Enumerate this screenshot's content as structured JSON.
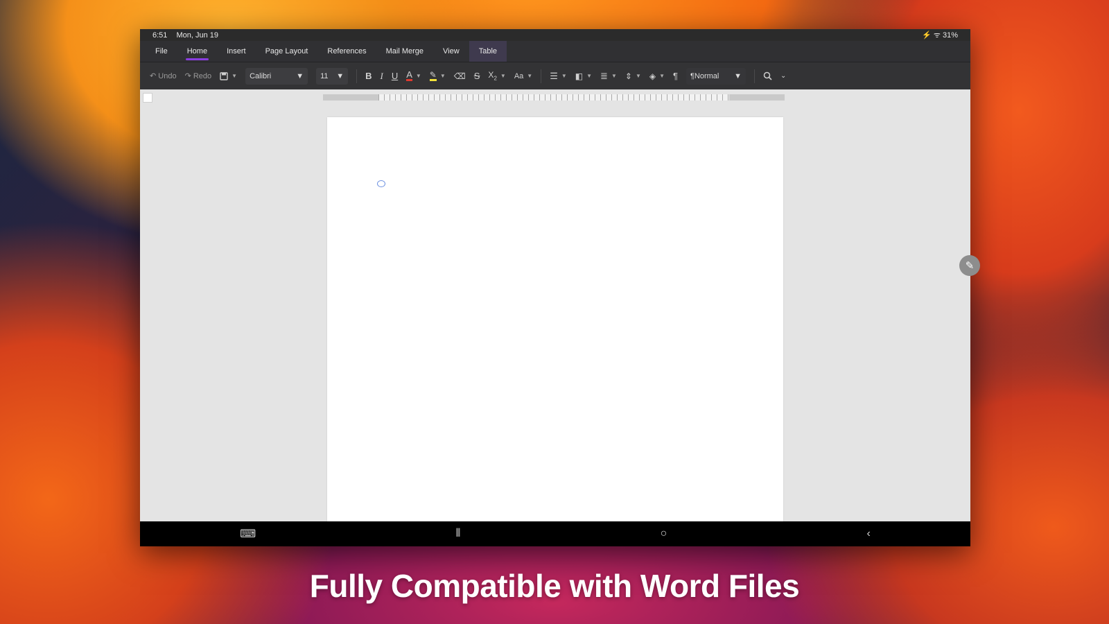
{
  "status_bar": {
    "time": "6:51",
    "date": "Mon, Jun 19",
    "indicators": "⚡ ᯤ 31%"
  },
  "menu": {
    "tabs": [
      {
        "label": "File"
      },
      {
        "label": "Home"
      },
      {
        "label": "Insert"
      },
      {
        "label": "Page Layout"
      },
      {
        "label": "References"
      },
      {
        "label": "Mail Merge"
      },
      {
        "label": "View"
      },
      {
        "label": "Table"
      }
    ],
    "active_tab": "Home"
  },
  "toolbar": {
    "undo_label": "Undo",
    "redo_label": "Redo",
    "font_name": "Calibri",
    "font_size": "11",
    "style_name": "¶Normal",
    "accent_color": "#8a3de0",
    "icons": [
      "save-icon",
      "bold-icon",
      "italic-icon",
      "underline-icon",
      "font-color-icon",
      "highlight-icon",
      "clear-format-icon",
      "strikethrough-icon",
      "subscript-icon",
      "change-case-icon",
      "list-icon",
      "indent-icon",
      "align-icon",
      "line-spacing-icon",
      "shading-icon",
      "paragraph-mark-icon",
      "search-icon",
      "more-icon"
    ]
  },
  "caption": "Fully Compatible with Word Files"
}
